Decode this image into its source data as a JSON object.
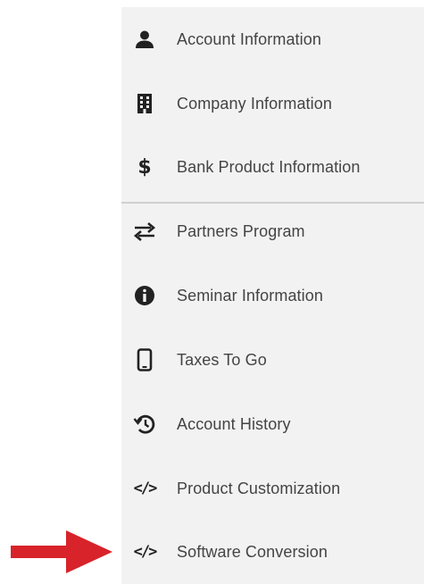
{
  "menu": {
    "items": [
      {
        "label": "Account Information",
        "icon": "person-icon"
      },
      {
        "label": "Company Information",
        "icon": "building-icon"
      },
      {
        "label": "Bank Product Information",
        "icon": "dollar-icon"
      },
      {
        "label": "Partners Program",
        "icon": "swap-arrows-icon"
      },
      {
        "label": "Seminar Information",
        "icon": "info-icon"
      },
      {
        "label": "Taxes To Go",
        "icon": "phone-icon"
      },
      {
        "label": "Account History",
        "icon": "history-icon"
      },
      {
        "label": "Product Customization",
        "icon": "code-icon"
      },
      {
        "label": "Software Conversion",
        "icon": "code-icon"
      }
    ],
    "code_glyph": "</>",
    "dollar_glyph": "$"
  },
  "colors": {
    "panel_background": "#f2f2f2",
    "label_text": "#444444",
    "icon": "#222222",
    "divider": "#d0d0d0",
    "pointer_arrow": "#d8232a"
  }
}
